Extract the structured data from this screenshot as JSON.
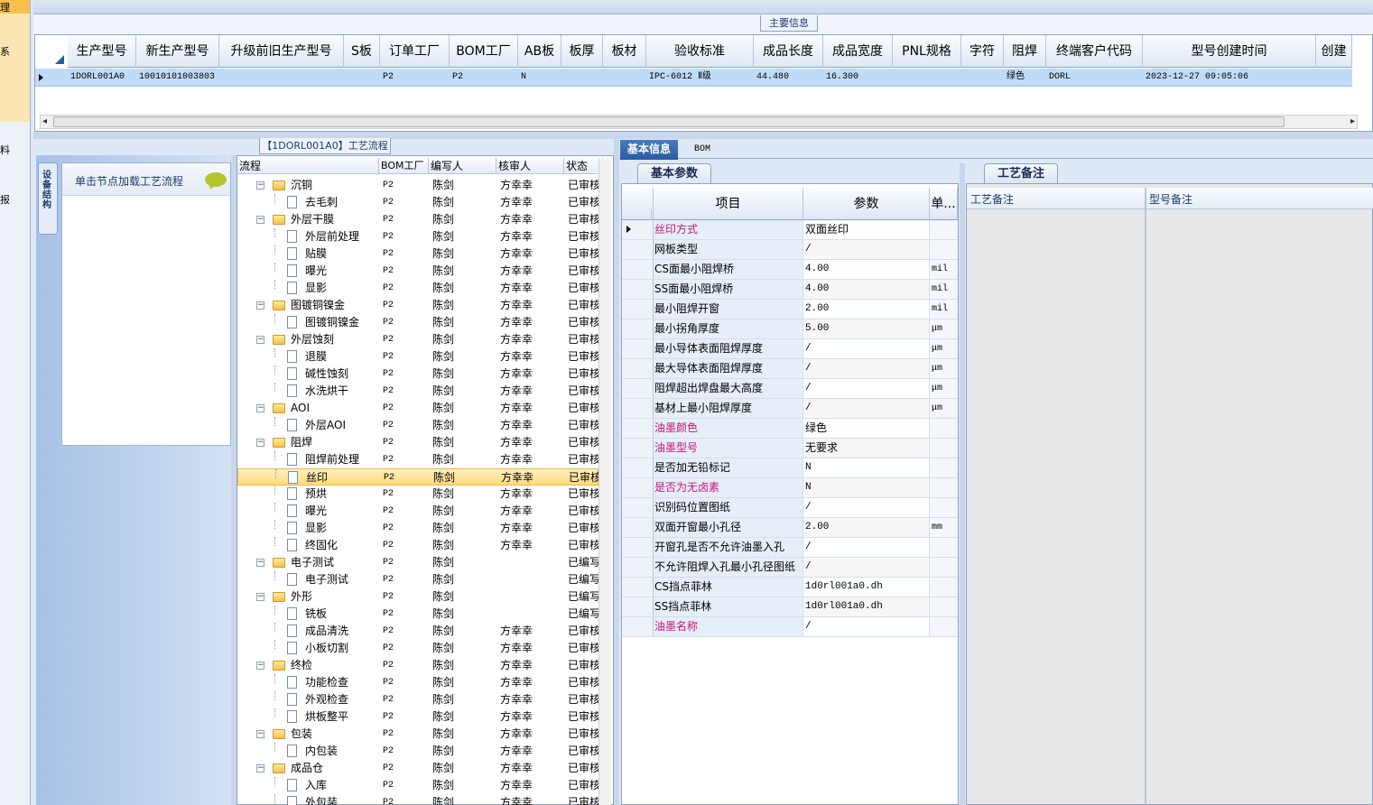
{
  "left_strip": {
    "labels": [
      "理",
      "系",
      "料",
      "报"
    ]
  },
  "top": {
    "section_title": "主要信息",
    "columns": [
      {
        "label": "生产型号",
        "w": 76
      },
      {
        "label": "新生产型号",
        "w": 92
      },
      {
        "label": "升级前旧生产型号",
        "w": 138
      },
      {
        "label": "S板",
        "w": 40
      },
      {
        "label": "订单工厂",
        "w": 77
      },
      {
        "label": "BOM工厂",
        "w": 76
      },
      {
        "label": "AB板",
        "w": 48
      },
      {
        "label": "板厚",
        "w": 46
      },
      {
        "label": "板材",
        "w": 48
      },
      {
        "label": "验收标准",
        "w": 119
      },
      {
        "label": "成品长度",
        "w": 77
      },
      {
        "label": "成品宽度",
        "w": 77
      },
      {
        "label": "PNL规格",
        "w": 76
      },
      {
        "label": "字符",
        "w": 47
      },
      {
        "label": "阻焊",
        "w": 47
      },
      {
        "label": "终端客户代码",
        "w": 107
      },
      {
        "label": "型号创建时间",
        "w": 192
      },
      {
        "label": "创建",
        "w": 40
      }
    ],
    "row": [
      "1DORL001A0",
      "10010101003803",
      "",
      "",
      "P2",
      "P2",
      "N",
      "",
      "",
      "IPC-6012 Ⅱ级",
      "44.480",
      "16.300",
      "",
      "",
      "绿色",
      "DORL",
      "2023-12-27 09:05:06",
      ""
    ]
  },
  "nav": {
    "vertical_tab": "设备结构",
    "card_label": "单击节点加载工艺流程"
  },
  "tree": {
    "title": "【1DORL001A0】工艺流程",
    "headers": [
      "流程",
      "BOM工厂",
      "编写人",
      "核审人",
      "状态"
    ],
    "rows": [
      {
        "level": 1,
        "name": "沉铜",
        "bom": "P2",
        "writer": "陈剑",
        "reviewer": "方幸幸",
        "status": "已审核"
      },
      {
        "level": 2,
        "name": "去毛刺",
        "bom": "P2",
        "writer": "陈剑",
        "reviewer": "方幸幸",
        "status": "已审核"
      },
      {
        "level": 1,
        "name": "外层干膜",
        "bom": "P2",
        "writer": "陈剑",
        "reviewer": "方幸幸",
        "status": "已审核"
      },
      {
        "level": 2,
        "name": "外层前处理",
        "bom": "P2",
        "writer": "陈剑",
        "reviewer": "方幸幸",
        "status": "已审核"
      },
      {
        "level": 2,
        "name": "贴膜",
        "bom": "P2",
        "writer": "陈剑",
        "reviewer": "方幸幸",
        "status": "已审核"
      },
      {
        "level": 2,
        "name": "曝光",
        "bom": "P2",
        "writer": "陈剑",
        "reviewer": "方幸幸",
        "status": "已审核"
      },
      {
        "level": 2,
        "name": "显影",
        "bom": "P2",
        "writer": "陈剑",
        "reviewer": "方幸幸",
        "status": "已审核"
      },
      {
        "level": 1,
        "name": "图镀铜镍金",
        "bom": "P2",
        "writer": "陈剑",
        "reviewer": "方幸幸",
        "status": "已审核"
      },
      {
        "level": 2,
        "name": "图镀铜镍金",
        "bom": "P2",
        "writer": "陈剑",
        "reviewer": "方幸幸",
        "status": "已审核"
      },
      {
        "level": 1,
        "name": "外层蚀刻",
        "bom": "P2",
        "writer": "陈剑",
        "reviewer": "方幸幸",
        "status": "已审核"
      },
      {
        "level": 2,
        "name": "退膜",
        "bom": "P2",
        "writer": "陈剑",
        "reviewer": "方幸幸",
        "status": "已审核"
      },
      {
        "level": 2,
        "name": "碱性蚀刻",
        "bom": "P2",
        "writer": "陈剑",
        "reviewer": "方幸幸",
        "status": "已审核"
      },
      {
        "level": 2,
        "name": "水洗烘干",
        "bom": "P2",
        "writer": "陈剑",
        "reviewer": "方幸幸",
        "status": "已审核"
      },
      {
        "level": 1,
        "name": "AOI",
        "bom": "P2",
        "writer": "陈剑",
        "reviewer": "方幸幸",
        "status": "已审核"
      },
      {
        "level": 2,
        "name": "外层AOI",
        "bom": "P2",
        "writer": "陈剑",
        "reviewer": "方幸幸",
        "status": "已审核"
      },
      {
        "level": 1,
        "name": "阻焊",
        "bom": "P2",
        "writer": "陈剑",
        "reviewer": "方幸幸",
        "status": "已审核"
      },
      {
        "level": 2,
        "name": "阻焊前处理",
        "bom": "P2",
        "writer": "陈剑",
        "reviewer": "方幸幸",
        "status": "已审核"
      },
      {
        "level": 2,
        "name": "丝印",
        "bom": "P2",
        "writer": "陈剑",
        "reviewer": "方幸幸",
        "status": "已审核",
        "selected": true
      },
      {
        "level": 2,
        "name": "预烘",
        "bom": "P2",
        "writer": "陈剑",
        "reviewer": "方幸幸",
        "status": "已审核"
      },
      {
        "level": 2,
        "name": "曝光",
        "bom": "P2",
        "writer": "陈剑",
        "reviewer": "方幸幸",
        "status": "已审核"
      },
      {
        "level": 2,
        "name": "显影",
        "bom": "P2",
        "writer": "陈剑",
        "reviewer": "方幸幸",
        "status": "已审核"
      },
      {
        "level": 2,
        "name": "终固化",
        "bom": "P2",
        "writer": "陈剑",
        "reviewer": "方幸幸",
        "status": "已审核"
      },
      {
        "level": 1,
        "name": "电子测试",
        "bom": "P2",
        "writer": "陈剑",
        "reviewer": "",
        "status": "已编写"
      },
      {
        "level": 2,
        "name": "电子测试",
        "bom": "P2",
        "writer": "陈剑",
        "reviewer": "",
        "status": "已编写"
      },
      {
        "level": 1,
        "name": "外形",
        "bom": "P2",
        "writer": "陈剑",
        "reviewer": "",
        "status": "已编写"
      },
      {
        "level": 2,
        "name": "铣板",
        "bom": "P2",
        "writer": "陈剑",
        "reviewer": "",
        "status": "已编写"
      },
      {
        "level": 2,
        "name": "成品清洗",
        "bom": "P2",
        "writer": "陈剑",
        "reviewer": "方幸幸",
        "status": "已审核"
      },
      {
        "level": 2,
        "name": "小板切割",
        "bom": "P2",
        "writer": "陈剑",
        "reviewer": "方幸幸",
        "status": "已审核"
      },
      {
        "level": 1,
        "name": "终检",
        "bom": "P2",
        "writer": "陈剑",
        "reviewer": "方幸幸",
        "status": "已审核"
      },
      {
        "level": 2,
        "name": "功能检查",
        "bom": "P2",
        "writer": "陈剑",
        "reviewer": "方幸幸",
        "status": "已审核"
      },
      {
        "level": 2,
        "name": "外观检查",
        "bom": "P2",
        "writer": "陈剑",
        "reviewer": "方幸幸",
        "status": "已审核"
      },
      {
        "level": 2,
        "name": "烘板整平",
        "bom": "P2",
        "writer": "陈剑",
        "reviewer": "方幸幸",
        "status": "已审核"
      },
      {
        "level": 1,
        "name": "包装",
        "bom": "P2",
        "writer": "陈剑",
        "reviewer": "方幸幸",
        "status": "已审核"
      },
      {
        "level": 2,
        "name": "内包装",
        "bom": "P2",
        "writer": "陈剑",
        "reviewer": "方幸幸",
        "status": "已审核"
      },
      {
        "level": 1,
        "name": "成品仓",
        "bom": "P2",
        "writer": "陈剑",
        "reviewer": "方幸幸",
        "status": "已审核"
      },
      {
        "level": 2,
        "name": "入库",
        "bom": "P2",
        "writer": "陈剑",
        "reviewer": "方幸幸",
        "status": "已审核"
      },
      {
        "level": 2,
        "name": "外包装",
        "bom": "P2",
        "writer": "陈剑",
        "reviewer": "方幸幸",
        "status": "已审核"
      }
    ]
  },
  "info": {
    "tabs": [
      "基本信息",
      "BOM"
    ],
    "params_title": "基本参数",
    "headers": [
      "项目",
      "参数",
      "单..."
    ],
    "rows": [
      {
        "item": "丝印方式",
        "value": "双面丝印",
        "unit": "",
        "pink": true
      },
      {
        "item": "网板类型",
        "value": "/",
        "unit": ""
      },
      {
        "item": "CS面最小阻焊桥",
        "value": "4.00",
        "unit": "mil"
      },
      {
        "item": "SS面最小阻焊桥",
        "value": "4.00",
        "unit": "mil"
      },
      {
        "item": "最小阻焊开窗",
        "value": "2.00",
        "unit": "mil"
      },
      {
        "item": "最小拐角厚度",
        "value": "5.00",
        "unit": "μm"
      },
      {
        "item": "最小导体表面阻焊厚度",
        "value": "/",
        "unit": "μm"
      },
      {
        "item": "最大导体表面阻焊厚度",
        "value": "/",
        "unit": "μm"
      },
      {
        "item": "阻焊超出焊盘最大高度",
        "value": "/",
        "unit": "μm"
      },
      {
        "item": "基材上最小阻焊厚度",
        "value": "/",
        "unit": "μm"
      },
      {
        "item": "油墨颜色",
        "value": "绿色",
        "unit": "",
        "pink": true
      },
      {
        "item": "油墨型号",
        "value": "无要求",
        "unit": "",
        "pink": true
      },
      {
        "item": "是否加无铅标记",
        "value": "N",
        "unit": ""
      },
      {
        "item": "是否为无卤素",
        "value": "N",
        "unit": "",
        "pink": true
      },
      {
        "item": "识别码位置图纸",
        "value": "/",
        "unit": ""
      },
      {
        "item": "双面开窗最小孔径",
        "value": "2.00",
        "unit": "mm"
      },
      {
        "item": "开窗孔是否不允许油墨入孔",
        "value": "/",
        "unit": ""
      },
      {
        "item": "不允许阻焊入孔最小孔径图纸",
        "value": "/",
        "unit": ""
      },
      {
        "item": "CS挡点菲林",
        "value": "1d0rl001a0.dh",
        "unit": ""
      },
      {
        "item": "SS挡点菲林",
        "value": "1d0rl001a0.dh",
        "unit": ""
      },
      {
        "item": "油墨名称",
        "value": "/",
        "unit": "",
        "pink": true
      }
    ]
  },
  "notes": {
    "title": "工艺备注",
    "col1": "工艺备注",
    "col2": "型号备注"
  },
  "colors": {
    "selected_row": "#bfdbf7",
    "pink_text": "#c2187a",
    "tab_active": "#2a5aa0"
  }
}
